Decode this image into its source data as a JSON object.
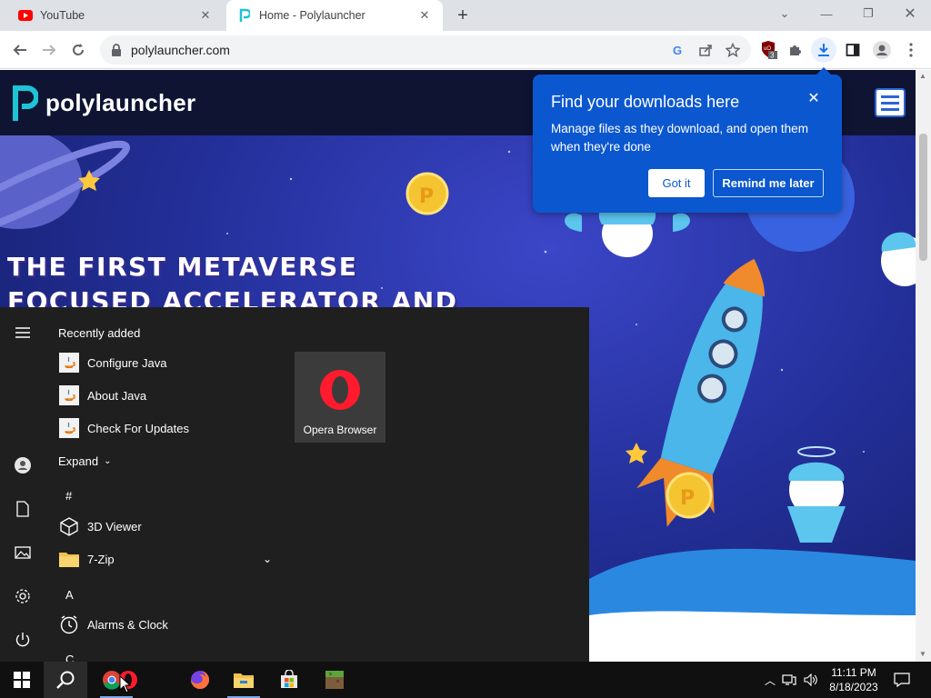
{
  "tabs": [
    {
      "title": "YouTube",
      "icon": "youtube-icon",
      "active": false
    },
    {
      "title": "Home - Polylauncher",
      "icon": "polylauncher-icon",
      "active": true
    }
  ],
  "toolbar": {
    "url": "polylauncher.com",
    "extension_badge": "3"
  },
  "site": {
    "brand": "polylauncher",
    "headline_line1": "THE FIRST METAVERSE",
    "headline_line2": "FOCUSED ACCELERATOR AND"
  },
  "downloads_bubble": {
    "title": "Find your downloads here",
    "body": "Manage files as they download, and open them when they're done",
    "got_it": "Got it",
    "remind_later": "Remind me later"
  },
  "start_menu": {
    "recently_added_label": "Recently added",
    "recent": [
      {
        "label": "Configure Java"
      },
      {
        "label": "About Java"
      },
      {
        "label": "Check For Updates"
      }
    ],
    "expand_label": "Expand",
    "sections": {
      "hash": "#",
      "a": "A",
      "c": "C"
    },
    "apps": [
      {
        "label": "3D Viewer"
      },
      {
        "label": "7-Zip"
      },
      {
        "label": "Alarms & Clock"
      }
    ],
    "tile": {
      "label": "Opera Browser"
    }
  },
  "taskbar": {
    "time": "11:11 PM",
    "date": "8/18/2023"
  },
  "colors": {
    "bubble_blue": "#0b57d0",
    "start_menu_bg": "#1f1f1f",
    "taskbar_bg": "#101010"
  }
}
